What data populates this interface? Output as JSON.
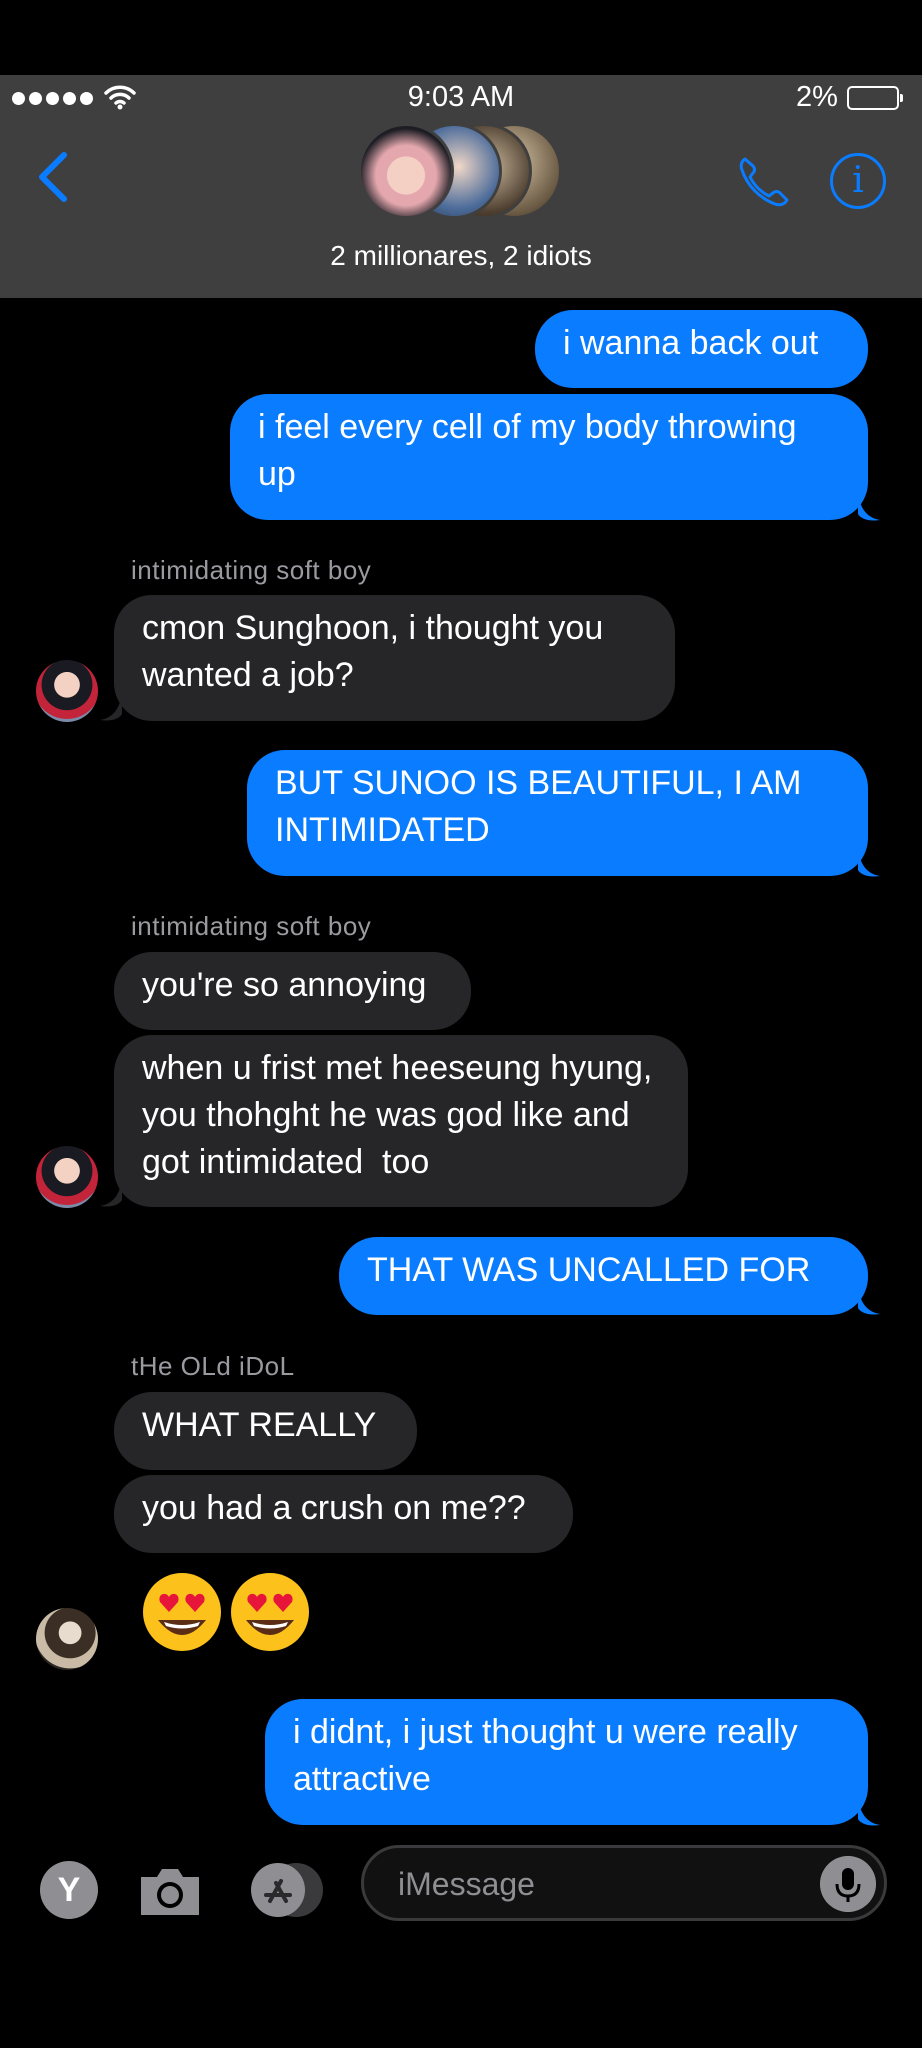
{
  "status": {
    "time": "9:03 AM",
    "battery_percent": "2%"
  },
  "header": {
    "group_name": "2 millionares, 2 idiots"
  },
  "messages": [
    {
      "dir": "sent",
      "text": "i wanna back out"
    },
    {
      "dir": "sent",
      "text": "i feel every cell of my body throwing up"
    },
    {
      "dir": "recv",
      "sender": "intimidating soft boy",
      "text": "cmon Sunghoon, i thought you wanted a job?"
    },
    {
      "dir": "sent",
      "text": "BUT SUNOO IS BEAUTIFUL, I AM INTIMIDATED"
    },
    {
      "dir": "recv",
      "sender": "intimidating soft boy",
      "text": "you're so annoying"
    },
    {
      "dir": "recv",
      "text": "when u frist met heeseung hyung, you thohght he was god like and got intimidated  too"
    },
    {
      "dir": "sent",
      "text": "THAT WAS UNCALLED FOR"
    },
    {
      "dir": "recv",
      "sender": "tHe OLd iDoL",
      "text": "WHAT REALLY"
    },
    {
      "dir": "recv",
      "text": "you had a crush on me??"
    },
    {
      "dir": "recv",
      "text": "😍😍"
    },
    {
      "dir": "sent",
      "text": "i didnt, i just thought u were really attractive"
    }
  ],
  "composer": {
    "placeholder": "iMessage",
    "app_button_label": "Y"
  },
  "colors": {
    "sent": "#0a7cff",
    "recv": "#262628",
    "header": "#3f3f3f",
    "accent": "#0a7cff"
  }
}
